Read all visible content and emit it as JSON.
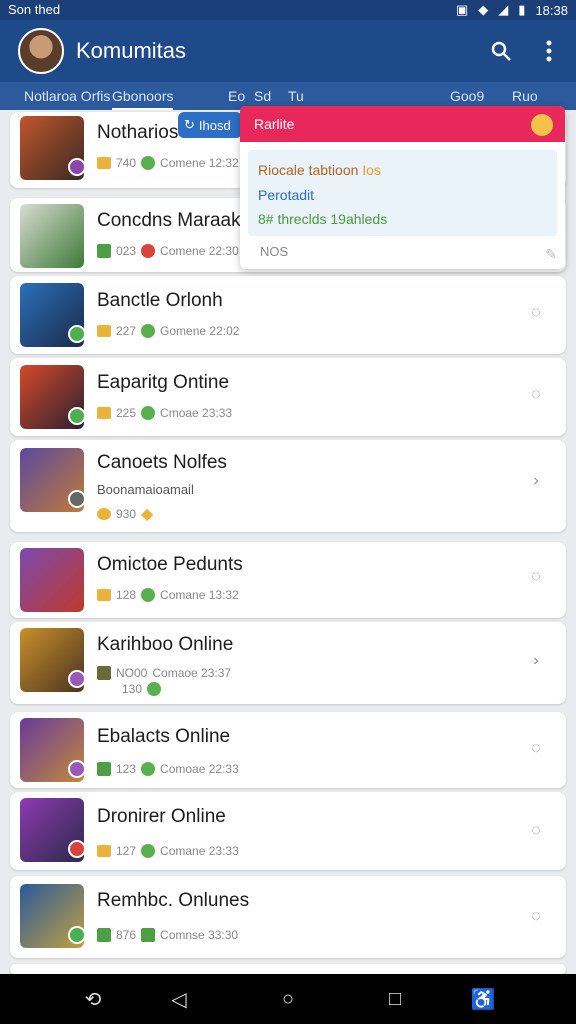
{
  "status": {
    "carrier": "Son thed",
    "time": "18:38"
  },
  "appbar": {
    "title": "Komumitas"
  },
  "tabs": [
    "Notlaroa Orfis",
    "Gbonoors",
    "Eo",
    "Sd",
    "Tu",
    "Goo9",
    "Ruo"
  ],
  "tooltip": {
    "label": "Ihosd"
  },
  "popup": {
    "title": "Rarlite",
    "line1": "Riocale tabtioon",
    "line1b": "Ios",
    "line2": "Perotadit",
    "line3": "8# threclds 19ahleds",
    "foot": "NOS"
  },
  "items": [
    {
      "title": "Notharios C",
      "meta": "740",
      "sub": "Comene 12:32"
    },
    {
      "title": "Concdns Maraaks",
      "meta": "023",
      "sub": "Comene 22:30"
    },
    {
      "title": "Banctle Orlonh",
      "meta": "227",
      "sub": "Gomene 22:02"
    },
    {
      "title": "Eaparitg Ontine",
      "meta": "225",
      "sub": "Cmoae 23:33"
    },
    {
      "title": "Canoets Nolfes",
      "meta": "Boonamaioamail",
      "sub": "930"
    },
    {
      "title": "Omictoe Pedunts",
      "meta": "128",
      "sub": "Comane 13:32"
    },
    {
      "title": "Karihboo Online",
      "meta": "NO00",
      "sub": "Comaoe 23:37",
      "sub2": "130"
    },
    {
      "title": "Ebalacts Online",
      "meta": "123",
      "sub": "Comoae 22:33"
    },
    {
      "title": "Dronirer Online",
      "meta": "127",
      "sub": "Comane 23:33"
    },
    {
      "title": "Remhbc. Onlunes",
      "meta": "876",
      "sub": "Comnse 33:30"
    }
  ],
  "icons": {
    "search": "search-icon",
    "menu": "more-vert-icon",
    "chat": "chat-bubble-icon",
    "chevron": "chevron-right-icon"
  }
}
